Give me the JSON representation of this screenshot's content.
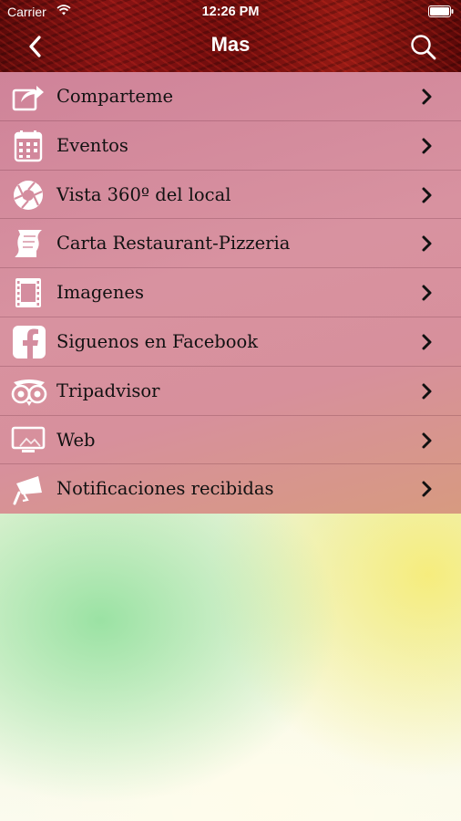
{
  "status_bar": {
    "carrier": "Carrier",
    "time": "12:26 PM",
    "wifi_icon": "wifi-icon",
    "battery_icon": "battery-icon"
  },
  "nav": {
    "title": "Mas",
    "back_icon": "chevron-left-icon",
    "search_icon": "search-icon"
  },
  "colors": {
    "header_red": "#7a1010",
    "menu_pink": "#d48d9f",
    "menu_bottom_orange": "#d79a80",
    "text": "#111111"
  },
  "menu": {
    "items": [
      {
        "label": "Comparteme",
        "icon": "share-icon"
      },
      {
        "label": "Eventos",
        "icon": "calendar-icon"
      },
      {
        "label": "Vista 360º del local",
        "icon": "aperture-icon"
      },
      {
        "label": "Carta Restaurant-Pizzeria",
        "icon": "scroll-icon"
      },
      {
        "label": "Imagenes",
        "icon": "film-icon"
      },
      {
        "label": "Siguenos en Facebook",
        "icon": "facebook-icon"
      },
      {
        "label": "Tripadvisor",
        "icon": "tripadvisor-owl-icon"
      },
      {
        "label": "Web",
        "icon": "monitor-icon"
      },
      {
        "label": "Notificaciones recibidas",
        "icon": "megaphone-icon"
      }
    ]
  }
}
